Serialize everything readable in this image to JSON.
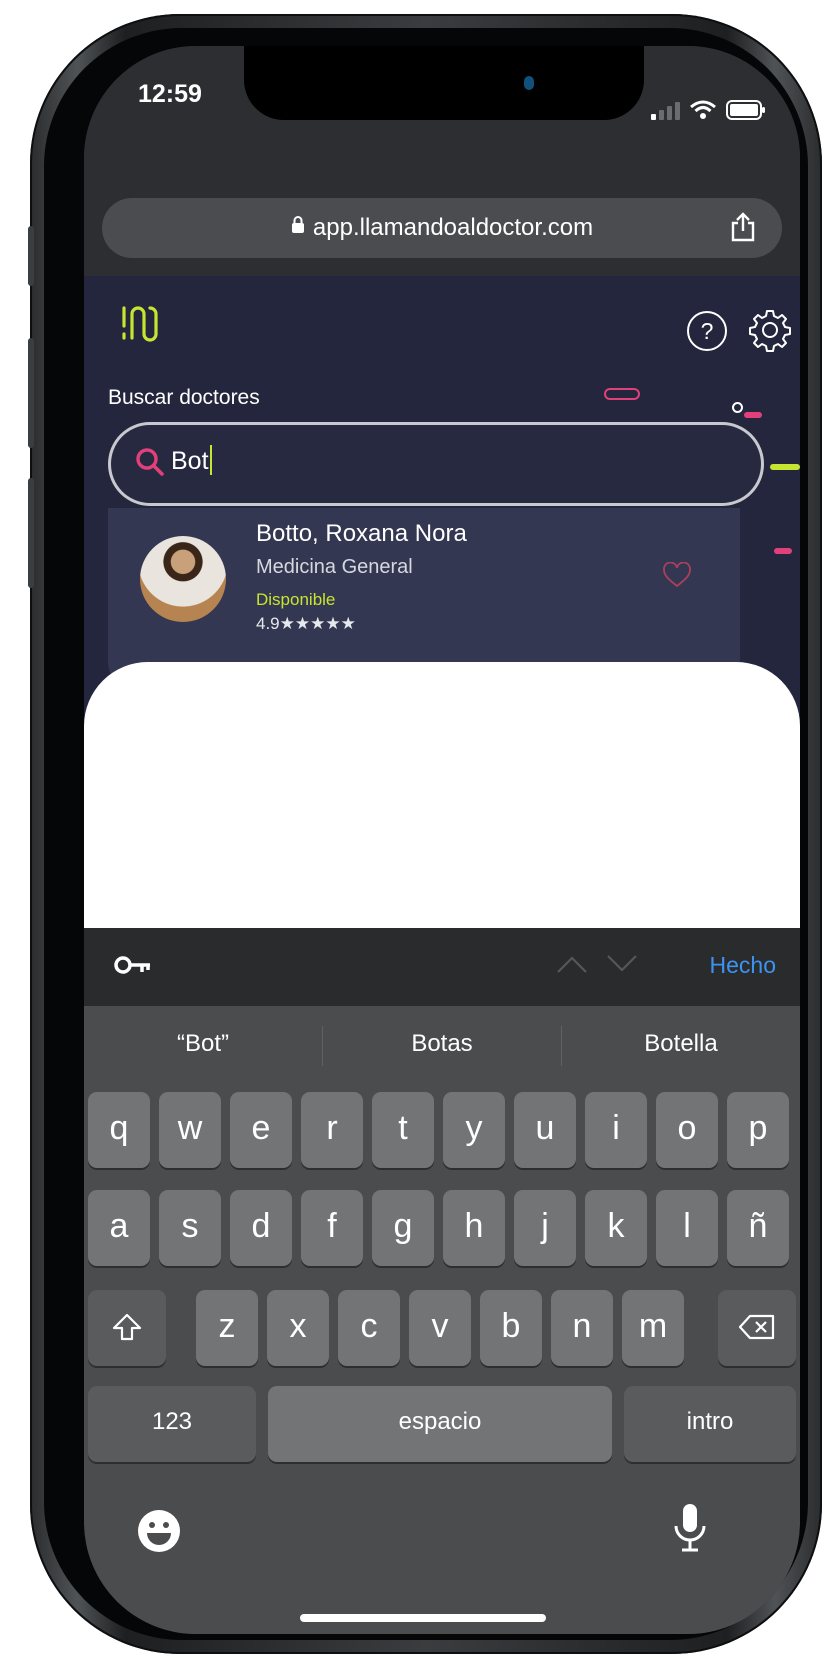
{
  "status_bar": {
    "time": "12:59"
  },
  "browser": {
    "url": "app.llamandoaldoctor.com"
  },
  "app": {
    "search_label": "Buscar doctores",
    "search_value": "Bot",
    "colors": {
      "accent_green": "#c6e531",
      "accent_pink": "#e2407a",
      "bg_navy": "#23263c"
    },
    "result": {
      "name": "Botto, Roxana Nora",
      "specialty": "Medicina General",
      "status": "Disponible",
      "rating": "4.9★★★★★"
    }
  },
  "keyboard": {
    "done_label": "Hecho",
    "suggestions": [
      "“Bot”",
      "Botas",
      "Botella"
    ],
    "row1": [
      "q",
      "w",
      "e",
      "r",
      "t",
      "y",
      "u",
      "i",
      "o",
      "p"
    ],
    "row2": [
      "a",
      "s",
      "d",
      "f",
      "g",
      "h",
      "j",
      "k",
      "l",
      "ñ"
    ],
    "row3": [
      "z",
      "x",
      "c",
      "v",
      "b",
      "n",
      "m"
    ],
    "numbers_label": "123",
    "space_label": "espacio",
    "return_label": "intro"
  }
}
